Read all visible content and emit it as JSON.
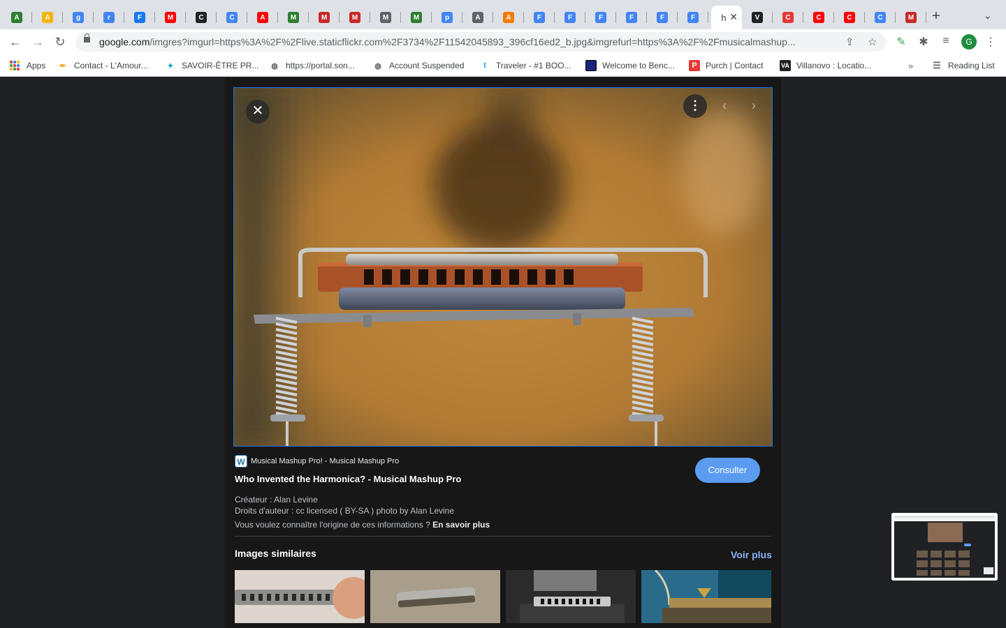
{
  "tabs": [
    {
      "letter": "A",
      "color": "#2e7d32"
    },
    {
      "letter": "A",
      "color": "#f4b400"
    },
    {
      "letter": "g",
      "color": "#4285f4"
    },
    {
      "letter": "r",
      "color": "#4285f4"
    },
    {
      "letter": "F",
      "color": "#1877f2"
    },
    {
      "letter": "M",
      "color": "#ff0000"
    },
    {
      "letter": "C",
      "color": "#202124"
    },
    {
      "letter": "C",
      "color": "#4285f4"
    },
    {
      "letter": "A",
      "color": "#ff0000"
    },
    {
      "letter": "M",
      "color": "#2e7d32"
    },
    {
      "letter": "M",
      "color": "#c62828"
    },
    {
      "letter": "M",
      "color": "#c62828"
    },
    {
      "letter": "M",
      "color": "#5f6368"
    },
    {
      "letter": "M",
      "color": "#2e7d32"
    },
    {
      "letter": "p",
      "color": "#4285f4"
    },
    {
      "letter": "A",
      "color": "#5f6368"
    },
    {
      "letter": "A",
      "color": "#f57c00"
    },
    {
      "letter": "F",
      "color": "#4285f4"
    },
    {
      "letter": "F",
      "color": "#4285f4"
    },
    {
      "letter": "F",
      "color": "#4285f4"
    },
    {
      "letter": "F",
      "color": "#4285f4"
    },
    {
      "letter": "F",
      "color": "#4285f4"
    },
    {
      "letter": "F",
      "color": "#4285f4"
    },
    {
      "letter": "h",
      "color": "#ffffff",
      "active": true
    },
    {
      "letter": "V",
      "color": "#202124"
    },
    {
      "letter": "C",
      "color": "#e53935"
    },
    {
      "letter": "C",
      "color": "#ff0000"
    },
    {
      "letter": "C",
      "color": "#ff0000"
    },
    {
      "letter": "C",
      "color": "#4285f4"
    },
    {
      "letter": "M",
      "color": "#c62828"
    }
  ],
  "address": {
    "host": "google.com",
    "path": "/imgres?imgurl=https%3A%2F%2Flive.staticflickr.com%2F3734%2F11542045893_396cf16ed2_b.jpg&imgrefurl=https%3A%2F%2Fmusicalmashup..."
  },
  "profile_initial": "G",
  "bookmarks": [
    {
      "label": "Apps",
      "icon": "apps-grid-icon"
    },
    {
      "label": "Contact - L'Amour...",
      "icon": "pencil-icon",
      "color": "#f9a825"
    },
    {
      "label": "SAVOIR-ÊTRE PR...",
      "icon": "sparkle-icon",
      "color": "#00acc1"
    },
    {
      "label": "https://portal.son...",
      "icon": "globe-icon",
      "color": "#5f6368"
    },
    {
      "label": "Account Suspended",
      "icon": "globe-icon",
      "color": "#5f6368"
    },
    {
      "label": "Traveler - #1 BOO...",
      "icon": "t-icon",
      "color": "#1da1f2"
    },
    {
      "label": "Welcome to Benc...",
      "icon": "bench-icon",
      "color": "#1a237e"
    },
    {
      "label": "Purch | Contact",
      "icon": "purch-icon",
      "color": "#e53935"
    },
    {
      "label": "Villanovo : Locatio...",
      "icon": "villanovo-icon",
      "color": "#202124"
    }
  ],
  "reading_list": "Reading List",
  "result": {
    "source": "Musical Mashup Pro! - Musical Mashup Pro",
    "title": "Who Invented the Harmonica? - Musical Mashup Pro",
    "consult_label": "Consulter",
    "creator": "Créateur : Alan Levine",
    "copyright": "Droits d'auteur : cc licensed ( BY-SA ) photo by Alan Levine",
    "origin_question": "Vous voulez connaître l'origine de ces informations ?",
    "learn_more": "En savoir plus"
  },
  "similar": {
    "heading": "Images similaires",
    "see_more": "Voir plus"
  },
  "colors": {
    "accent": "#1a73e8",
    "consult_bg": "#5b9cf0",
    "link": "#8ab4f8"
  }
}
